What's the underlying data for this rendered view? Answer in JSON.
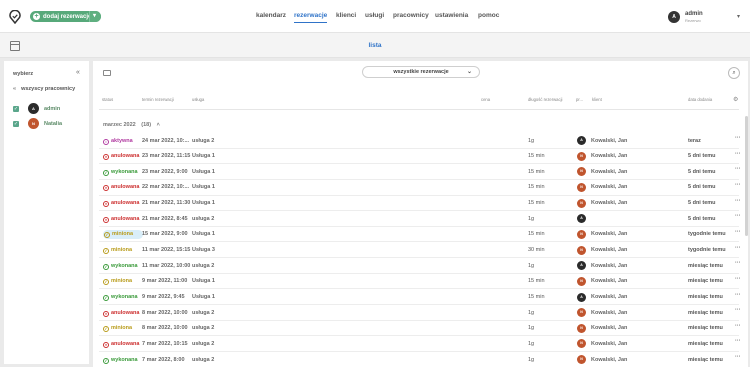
{
  "header": {
    "add_button_label": "dodaj rezerwację",
    "nav": [
      {
        "label": "kalendarz",
        "active": false
      },
      {
        "label": "rezerwacje",
        "active": true
      },
      {
        "label": "klienci",
        "active": false
      },
      {
        "label": "usługi",
        "active": false
      },
      {
        "label": "pracownicy",
        "active": false
      },
      {
        "label": "ustawienia",
        "active": false
      },
      {
        "label": "pomoc",
        "active": false
      }
    ],
    "user": {
      "initial": "A",
      "name": "admin",
      "role": "Rezerwo"
    }
  },
  "subheader": {
    "title": "lista"
  },
  "sidebar": {
    "title": "wybierz",
    "all_label": "wszyscy pracownicy",
    "employees": [
      {
        "initial": "A",
        "name": "admin",
        "color": "#2b2b2b"
      },
      {
        "initial": "N",
        "name": "Natalia",
        "color": "#c0552e"
      }
    ]
  },
  "toolbar": {
    "filter_label": "wszystkie rezerwacje"
  },
  "columns": {
    "status": "status",
    "date": "termin rezerwacji",
    "service": "usługa",
    "price": "cena",
    "duration": "długość rezerwacji",
    "employee": "pr...",
    "client": "klient",
    "added": "data dodania"
  },
  "group": {
    "label": "marzec 2022",
    "count": "(18)"
  },
  "status_colors": {
    "aktywna": "#b03aa0",
    "anulowana": "#cc2f2f",
    "wykonana": "#3a9a3a",
    "miniona": "#b89b1a"
  },
  "rows": [
    {
      "status": "aktywna",
      "date": "24 mar 2022, 10:...",
      "service": "usługa 2",
      "duration": "1g",
      "emp_initial": "A",
      "emp_color": "#2b2b2b",
      "client": "Kowalski, Jan",
      "added": "teraz"
    },
    {
      "status": "anulowana",
      "date": "23 mar 2022, 11:15",
      "service": "Usługa 1",
      "duration": "15 min",
      "emp_initial": "N",
      "emp_color": "#c0552e",
      "client": "Kowalski, Jan",
      "added": "5 dni temu"
    },
    {
      "status": "wykonana",
      "date": "23 mar 2022, 9:00",
      "service": "Usługa 1",
      "duration": "15 min",
      "emp_initial": "N",
      "emp_color": "#c0552e",
      "client": "Kowalski, Jan",
      "added": "5 dni temu"
    },
    {
      "status": "anulowana",
      "date": "22 mar 2022, 10:...",
      "service": "Usługa 1",
      "duration": "15 min",
      "emp_initial": "N",
      "emp_color": "#c0552e",
      "client": "Kowalski, Jan",
      "added": "5 dni temu"
    },
    {
      "status": "anulowana",
      "date": "21 mar 2022, 11:30",
      "service": "Usługa 1",
      "duration": "15 min",
      "emp_initial": "N",
      "emp_color": "#c0552e",
      "client": "Kowalski, Jan",
      "added": "5 dni temu"
    },
    {
      "status": "anulowana",
      "date": "21 mar 2022, 8:45",
      "service": "usługa 2",
      "duration": "1g",
      "emp_initial": "A",
      "emp_color": "#2b2b2b",
      "client": "",
      "added": "5 dni temu"
    },
    {
      "status": "miniona",
      "date": "15 mar 2022, 9:00",
      "service": "Usługa 1",
      "duration": "15 min",
      "emp_initial": "N",
      "emp_color": "#c0552e",
      "client": "Kowalski, Jan",
      "added": "tygodnie temu",
      "highlight": true
    },
    {
      "status": "miniona",
      "date": "11 mar 2022, 15:15",
      "service": "Usługa 3",
      "duration": "30 min",
      "emp_initial": "N",
      "emp_color": "#c0552e",
      "client": "Kowalski, Jan",
      "added": "tygodnie temu"
    },
    {
      "status": "wykonana",
      "date": "11 mar 2022, 10:00",
      "service": "usługa 2",
      "duration": "1g",
      "emp_initial": "A",
      "emp_color": "#2b2b2b",
      "client": "Kowalski, Jan",
      "added": "miesiąc temu"
    },
    {
      "status": "miniona",
      "date": "9 mar 2022, 11:00",
      "service": "Usługa 1",
      "duration": "15 min",
      "emp_initial": "N",
      "emp_color": "#c0552e",
      "client": "Kowalski, Jan",
      "added": "miesiąc temu"
    },
    {
      "status": "wykonana",
      "date": "9 mar 2022, 9:45",
      "service": "Usługa 1",
      "duration": "15 min",
      "emp_initial": "A",
      "emp_color": "#2b2b2b",
      "client": "Kowalski, Jan",
      "added": "miesiąc temu"
    },
    {
      "status": "anulowana",
      "date": "8 mar 2022, 10:00",
      "service": "usługa 2",
      "duration": "1g",
      "emp_initial": "N",
      "emp_color": "#c0552e",
      "client": "Kowalski, Jan",
      "added": "miesiąc temu"
    },
    {
      "status": "miniona",
      "date": "8 mar 2022, 10:00",
      "service": "usługa 2",
      "duration": "1g",
      "emp_initial": "N",
      "emp_color": "#c0552e",
      "client": "Kowalski, Jan",
      "added": "miesiąc temu"
    },
    {
      "status": "anulowana",
      "date": "7 mar 2022, 10:15",
      "service": "usługa 2",
      "duration": "1g",
      "emp_initial": "N",
      "emp_color": "#c0552e",
      "client": "Kowalski, Jan",
      "added": "miesiąc temu"
    },
    {
      "status": "wykonana",
      "date": "7 mar 2022, 8:00",
      "service": "usługa 2",
      "duration": "1g",
      "emp_initial": "N",
      "emp_color": "#c0552e",
      "client": "Kowalski, Jan",
      "added": "miesiąc temu"
    }
  ]
}
